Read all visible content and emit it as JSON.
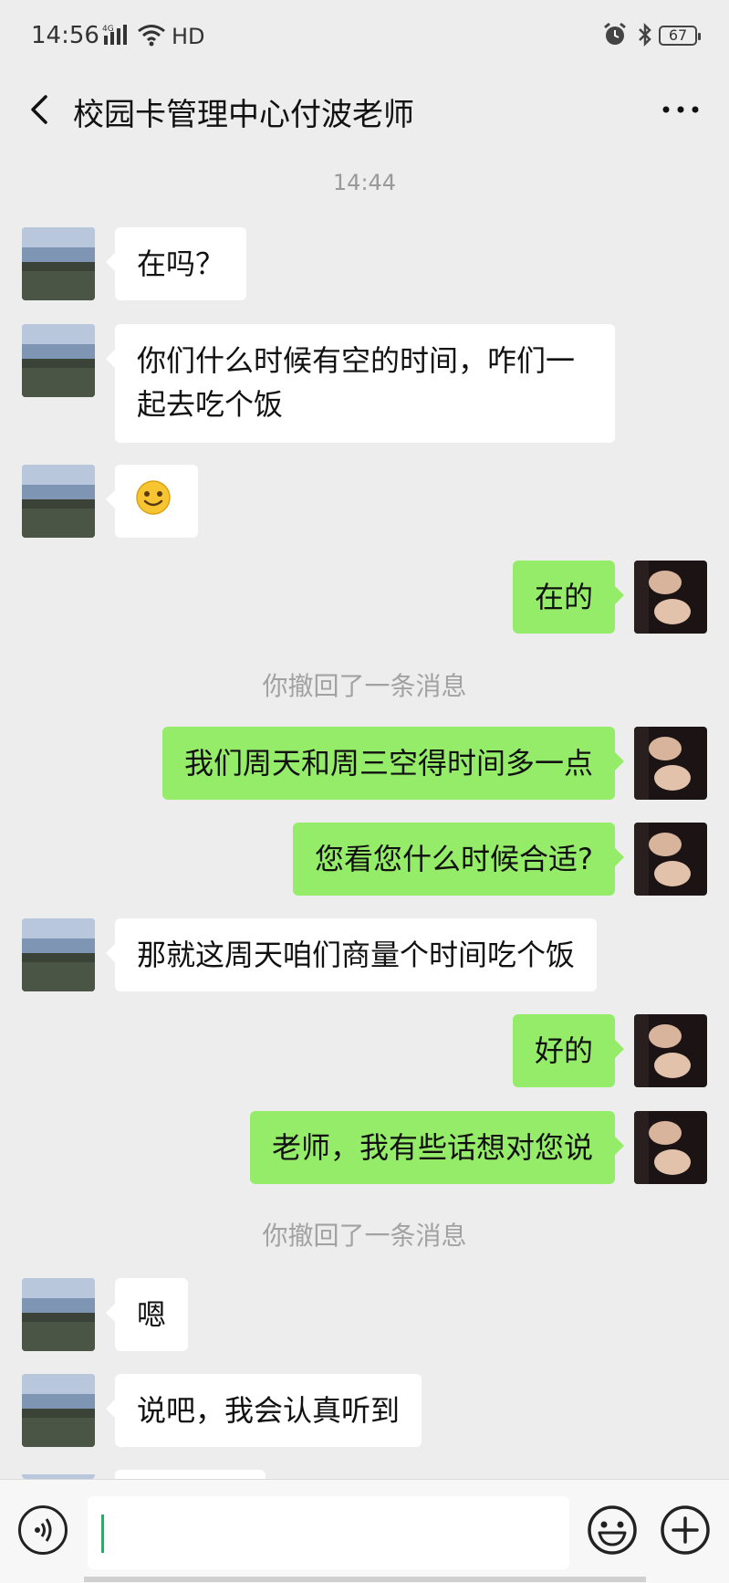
{
  "status_bar": {
    "time": "14:56",
    "network": "4G",
    "hd": "HD",
    "battery": "67"
  },
  "header": {
    "title": "校园卡管理中心付波老师"
  },
  "messages": [
    {
      "type": "timestamp",
      "text": "14:44"
    },
    {
      "type": "in",
      "text": "在吗？"
    },
    {
      "type": "in",
      "text": "你们什么时候有空的时间，咋们一起去吃个饭"
    },
    {
      "type": "in",
      "emoji": "smile-emoji"
    },
    {
      "type": "out",
      "text": "在的"
    },
    {
      "type": "system",
      "text": "你撤回了一条消息"
    },
    {
      "type": "out",
      "text": "我们周天和周三空得时间多一点"
    },
    {
      "type": "out",
      "text": "您看您什么时候合适?"
    },
    {
      "type": "in",
      "text": "那就这周天咱们商量个时间吃个饭"
    },
    {
      "type": "out",
      "text": "好的"
    },
    {
      "type": "out",
      "text": "老师，我有些话想对您说"
    },
    {
      "type": "system",
      "text": "你撤回了一条消息"
    },
    {
      "type": "in",
      "text": "嗯"
    },
    {
      "type": "in",
      "text": "说吧，我会认真听到"
    }
  ],
  "input_bar": {
    "value": "",
    "icons": [
      "voice-icon",
      "emoji-icon",
      "plus-icon"
    ]
  },
  "colors": {
    "background": "#ededed",
    "outgoing_bubble": "#95ec69",
    "incoming_bubble": "#ffffff",
    "caret": "#07c160"
  }
}
